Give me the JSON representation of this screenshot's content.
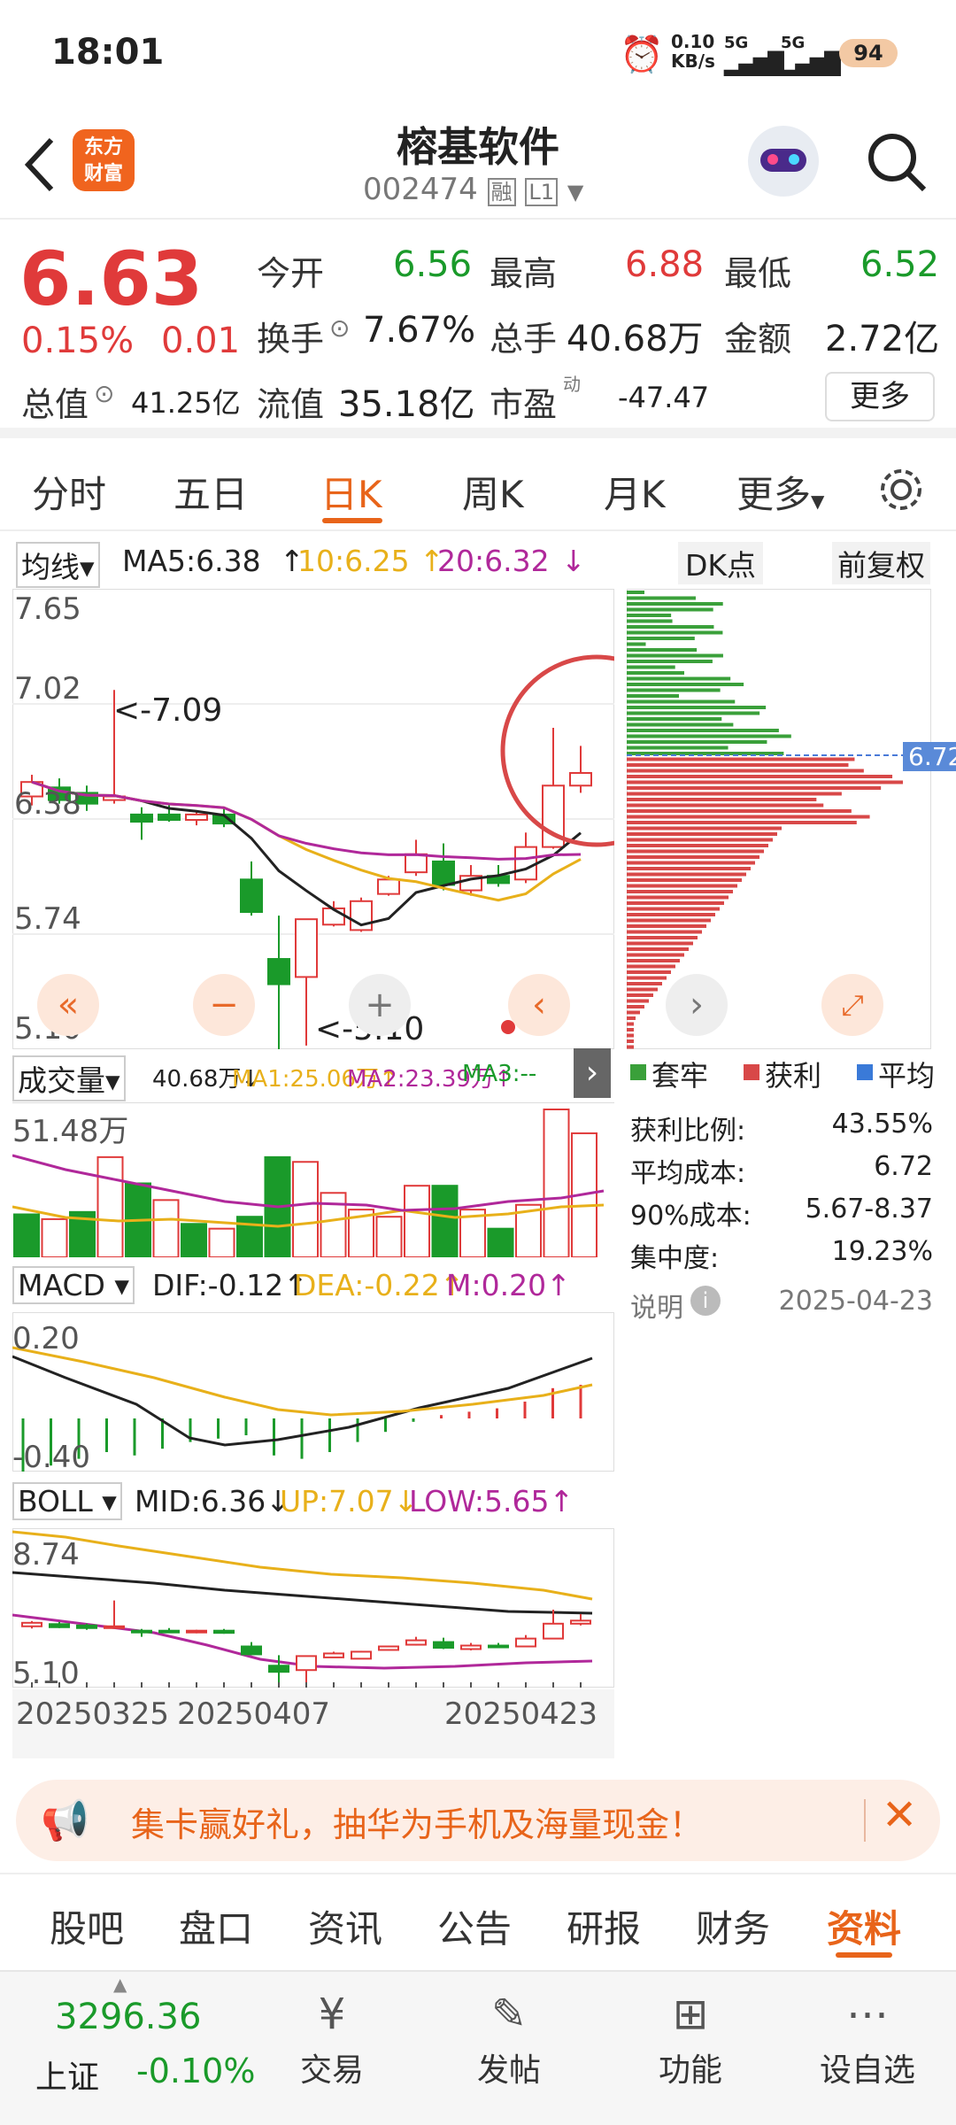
{
  "status": {
    "time": "18:01",
    "net_speed": "0.10",
    "net_unit": "KB/s",
    "sig1": "5G",
    "sig2": "5G",
    "battery": "94"
  },
  "header": {
    "logo_line1": "东方",
    "logo_line2": "财富",
    "title": "榕基软件",
    "code": "002474",
    "tag_rong": "融",
    "tag_l1": "L1"
  },
  "quote": {
    "price": "6.63",
    "change_pct": "0.15%",
    "change": "0.01",
    "open_label": "今开",
    "open": "6.56",
    "high_label": "最高",
    "high": "6.88",
    "low_label": "最低",
    "low": "6.52",
    "turnover_label": "换手",
    "turnover": "7.67%",
    "volume_label": "总手",
    "volume": "40.68万",
    "amount_label": "金额",
    "amount": "2.72亿",
    "mcap_label": "总值",
    "mcap": "41.25亿",
    "float_label": "流值",
    "float": "35.18亿",
    "pe_label": "市盈",
    "pe_sup": "动",
    "pe": "-47.47",
    "more": "更多"
  },
  "tabs": [
    "分时",
    "五日",
    "日K",
    "周K",
    "月K",
    "更多"
  ],
  "kline": {
    "ma_select": "均线",
    "ma5": "MA5:6.38",
    "ma10": "10:6.25",
    "ma20": "20:6.32",
    "dk": "DK点",
    "fq": "前复权",
    "y_ticks": [
      "7.65",
      "7.02",
      "6.38",
      "5.74",
      "5.10"
    ],
    "max_annot": "<-7.09",
    "min_annot": "<-5.10",
    "candles": [
      {
        "o": 6.5,
        "c": 6.58,
        "h": 6.62,
        "l": 6.45
      },
      {
        "o": 6.55,
        "c": 6.48,
        "h": 6.6,
        "l": 6.46
      },
      {
        "o": 6.52,
        "c": 6.46,
        "h": 6.56,
        "l": 6.42
      },
      {
        "o": 6.48,
        "c": 6.5,
        "h": 7.09,
        "l": 6.46
      },
      {
        "o": 6.4,
        "c": 6.36,
        "h": 6.44,
        "l": 6.26
      },
      {
        "o": 6.4,
        "c": 6.37,
        "h": 6.46,
        "l": 6.36
      },
      {
        "o": 6.37,
        "c": 6.4,
        "h": 6.42,
        "l": 6.34
      },
      {
        "o": 6.4,
        "c": 6.35,
        "h": 6.44,
        "l": 6.33
      },
      {
        "o": 6.04,
        "c": 5.86,
        "h": 6.14,
        "l": 5.84
      },
      {
        "o": 5.6,
        "c": 5.46,
        "h": 5.84,
        "l": 5.1
      },
      {
        "o": 5.5,
        "c": 5.82,
        "h": 5.82,
        "l": 5.12
      },
      {
        "o": 5.79,
        "c": 5.88,
        "h": 5.92,
        "l": 5.78
      },
      {
        "o": 5.76,
        "c": 5.92,
        "h": 5.94,
        "l": 5.75
      },
      {
        "o": 5.96,
        "c": 6.04,
        "h": 6.06,
        "l": 5.95
      },
      {
        "o": 6.08,
        "c": 6.18,
        "h": 6.26,
        "l": 6.06
      },
      {
        "o": 6.14,
        "c": 6.01,
        "h": 6.24,
        "l": 5.98
      },
      {
        "o": 5.98,
        "c": 6.06,
        "h": 6.12,
        "l": 5.95
      },
      {
        "o": 6.06,
        "c": 6.02,
        "h": 6.12,
        "l": 6.0
      },
      {
        "o": 6.04,
        "c": 6.22,
        "h": 6.3,
        "l": 6.02
      },
      {
        "o": 6.22,
        "c": 6.56,
        "h": 6.88,
        "l": 6.21
      },
      {
        "o": 6.56,
        "c": 6.63,
        "h": 6.78,
        "l": 6.52
      }
    ],
    "side": {
      "label": "6.72"
    }
  },
  "vol": {
    "label": "成交量",
    "val": "40.68万↓",
    "ma1": "MA1:25.06万↑",
    "ma2": "MA2:23.39万↑",
    "ma3": "MA3:--",
    "top": "51.48万",
    "bars": [
      18,
      16,
      19,
      42,
      31,
      24,
      14,
      12,
      17,
      42,
      40,
      27,
      20,
      17,
      30,
      30,
      20,
      12,
      22,
      62,
      52
    ],
    "colors": [
      "g",
      "r",
      "g",
      "r",
      "g",
      "r",
      "g",
      "r",
      "g",
      "g",
      "r",
      "r",
      "r",
      "r",
      "r",
      "g",
      "r",
      "g",
      "r",
      "r",
      "r"
    ]
  },
  "macd": {
    "label": "MACD",
    "dif": "DIF:-0.12↑",
    "dea": "DEA:-0.22↑",
    "m": "M:0.20↑",
    "top": "0.20",
    "bottom": "-0.40",
    "bars": [
      -0.32,
      -0.28,
      -0.24,
      -0.2,
      -0.22,
      -0.18,
      -0.14,
      -0.12,
      -0.1,
      -0.22,
      -0.24,
      -0.2,
      -0.14,
      -0.08,
      -0.02,
      0.02,
      0.04,
      0.06,
      0.1,
      0.18,
      0.2
    ]
  },
  "boll": {
    "label": "BOLL",
    "mid": "MID:6.36↓",
    "up": "UP:7.07↓",
    "low": "LOW:5.65↑",
    "top": "8.74",
    "bottom": "5.10",
    "dates": [
      "20250325",
      "20250407",
      "20250423"
    ]
  },
  "chip": {
    "legend": [
      "套牢",
      "获利",
      "平均"
    ],
    "rows": [
      {
        "label": "获利比例:",
        "value": "43.55%"
      },
      {
        "label": "平均成本:",
        "value": "6.72"
      },
      {
        "label": "90%成本:",
        "value": "5.67-8.37"
      },
      {
        "label": "集中度:",
        "value": "19.23%"
      }
    ],
    "note": "说明",
    "date": "2025-04-23"
  },
  "promo": {
    "text": "集卡赢好礼，抽华为手机及海量现金！"
  },
  "bottom_tabs": [
    "股吧",
    "盘口",
    "资讯",
    "公告",
    "研报",
    "财务",
    "资料"
  ],
  "nav": {
    "index_value": "3296.36",
    "index_name": "上证",
    "index_change": "-0.10%",
    "items": [
      "交易",
      "发帖",
      "功能",
      "设自选"
    ]
  },
  "colors": {
    "up": "#e03a3a",
    "down": "#1a9a2a",
    "accent": "#e8641a",
    "ma5": "#222222",
    "ma10": "#e8b01a",
    "ma20": "#b0289a"
  }
}
